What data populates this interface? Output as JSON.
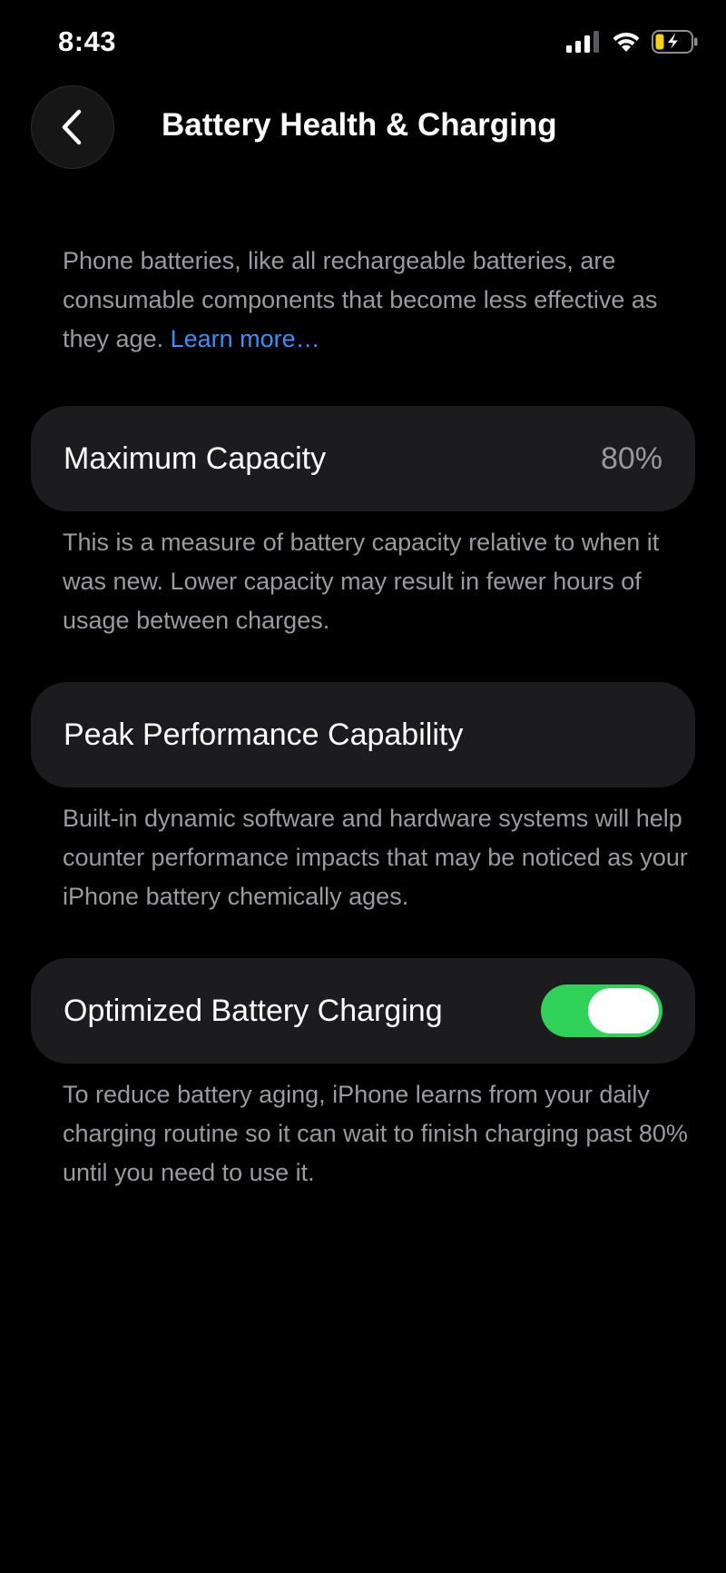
{
  "status_bar": {
    "time": "8:43",
    "icons": [
      "cellular-signal-icon",
      "wifi-icon",
      "battery-charging-icon"
    ],
    "battery_color": "#f5d20d"
  },
  "nav": {
    "back_icon": "chevron-left-icon",
    "title": "Battery Health & Charging"
  },
  "intro": {
    "text": "Phone batteries, like all rechargeable batteries, are consumable components that become less effective as they age.",
    "link": "Learn more…"
  },
  "maximum_capacity": {
    "label": "Maximum Capacity",
    "value": "80%",
    "description": "This is a measure of battery capacity relative to when it was new. Lower capacity may result in fewer hours of usage between charges."
  },
  "peak_performance": {
    "label": "Peak Performance Capability",
    "description": "Built-in dynamic software and hardware systems will help counter performance impacts that may be noticed as your iPhone battery chemically ages."
  },
  "optimized_charging": {
    "label": "Optimized Battery Charging",
    "enabled": true,
    "toggle_color": "#30d158",
    "description": "To reduce battery aging, iPhone learns from your daily charging routine so it can wait to finish charging past 80% until you need to use it."
  },
  "colors": {
    "background": "#000000",
    "card": "#1c1c1e",
    "secondary_text": "#9a9a9f",
    "link": "#3d8ef7"
  }
}
